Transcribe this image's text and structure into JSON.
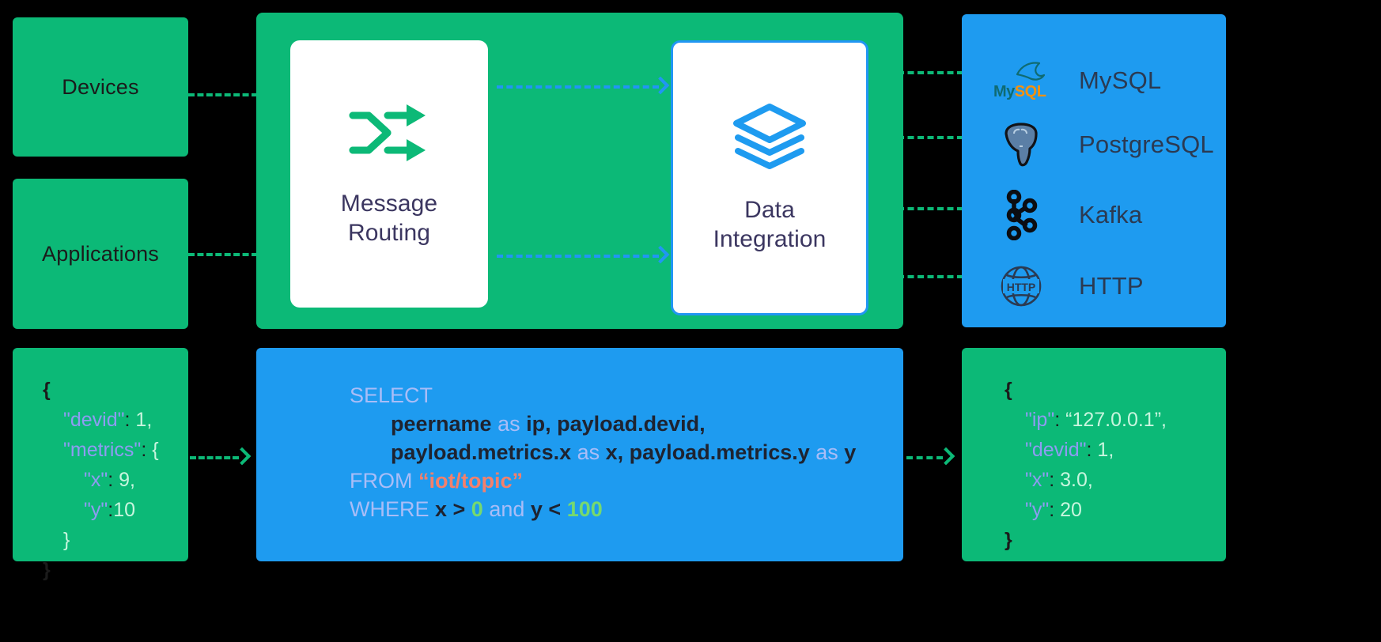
{
  "left_sources": [
    {
      "id": "devices",
      "label": "Devices"
    },
    {
      "id": "applications",
      "label": "Applications"
    }
  ],
  "pipeline": {
    "cards": [
      {
        "id": "message-routing",
        "icon": "shuffle-icon",
        "label": "Message\nRouting",
        "line1": "Message",
        "line2": "Routing"
      },
      {
        "id": "data-integration",
        "icon": "layers-icon",
        "label": "Data\nIntegration",
        "line1": "Data",
        "line2": "Integration"
      }
    ]
  },
  "destinations": {
    "items": [
      {
        "id": "mysql",
        "icon": "mysql-icon",
        "label": "MySQL"
      },
      {
        "id": "postgresql",
        "icon": "postgresql-icon",
        "label": "PostgreSQL"
      },
      {
        "id": "kafka",
        "icon": "kafka-icon",
        "label": "Kafka"
      },
      {
        "id": "http",
        "icon": "http-icon",
        "label": "HTTP"
      }
    ]
  },
  "input_payload": {
    "lines": [
      {
        "indent": 0,
        "parts": [
          {
            "t": "{",
            "c": "brace"
          }
        ]
      },
      {
        "indent": 1,
        "parts": [
          {
            "t": "\"devid\"",
            "c": "key"
          },
          {
            "t": ": ",
            "c": "punc"
          },
          {
            "t": "1,",
            "c": "val"
          }
        ]
      },
      {
        "indent": 1,
        "parts": [
          {
            "t": "\"metrics\"",
            "c": "key"
          },
          {
            "t": ": ",
            "c": "punc"
          },
          {
            "t": "{",
            "c": "val"
          }
        ]
      },
      {
        "indent": 2,
        "parts": [
          {
            "t": "\"x\"",
            "c": "key"
          },
          {
            "t": ": ",
            "c": "punc"
          },
          {
            "t": "9,",
            "c": "val"
          }
        ]
      },
      {
        "indent": 2,
        "parts": [
          {
            "t": "\"y\"",
            "c": "key"
          },
          {
            "t": ":",
            "c": "punc"
          },
          {
            "t": "10",
            "c": "val"
          }
        ]
      },
      {
        "indent": 1,
        "parts": [
          {
            "t": "}",
            "c": "val"
          }
        ]
      },
      {
        "indent": 0,
        "parts": [
          {
            "t": "}",
            "c": "brace"
          }
        ]
      }
    ]
  },
  "sql_rule": {
    "lines": [
      {
        "indent": 0,
        "parts": [
          {
            "t": "SELECT",
            "c": "kw"
          }
        ]
      },
      {
        "indent": 1,
        "parts": [
          {
            "t": "peername ",
            "c": "txt"
          },
          {
            "t": "as",
            "c": "kw"
          },
          {
            "t": " ip, payload.devid,",
            "c": "txt"
          }
        ]
      },
      {
        "indent": 1,
        "parts": [
          {
            "t": "payload.metrics.x ",
            "c": "txt"
          },
          {
            "t": "as",
            "c": "kw"
          },
          {
            "t": " x, payload.metrics.y ",
            "c": "txt"
          },
          {
            "t": "as",
            "c": "kw"
          },
          {
            "t": " y",
            "c": "txt"
          }
        ]
      },
      {
        "indent": 0,
        "parts": [
          {
            "t": "FROM ",
            "c": "kw"
          },
          {
            "t": "“iot/topic”",
            "c": "str"
          }
        ]
      },
      {
        "indent": 0,
        "parts": [
          {
            "t": "WHERE ",
            "c": "kw"
          },
          {
            "t": "x > ",
            "c": "txt"
          },
          {
            "t": "0",
            "c": "num"
          },
          {
            "t": " and ",
            "c": "kw"
          },
          {
            "t": "y < ",
            "c": "txt"
          },
          {
            "t": "100",
            "c": "num"
          }
        ]
      }
    ]
  },
  "output_payload": {
    "lines": [
      {
        "indent": 0,
        "parts": [
          {
            "t": "{",
            "c": "brace"
          }
        ]
      },
      {
        "indent": 1,
        "parts": [
          {
            "t": "\"ip\"",
            "c": "key"
          },
          {
            "t": ": ",
            "c": "punc"
          },
          {
            "t": "“127.0.0.1”,",
            "c": "val"
          }
        ]
      },
      {
        "indent": 1,
        "parts": [
          {
            "t": "\"devid\"",
            "c": "key"
          },
          {
            "t": ": ",
            "c": "punc"
          },
          {
            "t": "1,",
            "c": "val"
          }
        ]
      },
      {
        "indent": 1,
        "parts": [
          {
            "t": "\"x\"",
            "c": "key"
          },
          {
            "t": ": ",
            "c": "punc"
          },
          {
            "t": "3.0,",
            "c": "val"
          }
        ]
      },
      {
        "indent": 1,
        "parts": [
          {
            "t": "\"y\"",
            "c": "key"
          },
          {
            "t": ": ",
            "c": "punc"
          },
          {
            "t": "20",
            "c": "val"
          }
        ]
      },
      {
        "indent": 0,
        "parts": [
          {
            "t": "}",
            "c": "brace"
          }
        ]
      }
    ]
  },
  "colors": {
    "green": "#0CB977",
    "blue": "#1E9BF0",
    "accent_blue": "#2196F3",
    "card_text": "#3b3660",
    "json_key": "#8f9bf2",
    "json_value": "#c8f5de",
    "sql_keyword": "#a9bdf7",
    "sql_string": "#f4806c",
    "sql_number": "#76d96f",
    "background": "#000000"
  }
}
